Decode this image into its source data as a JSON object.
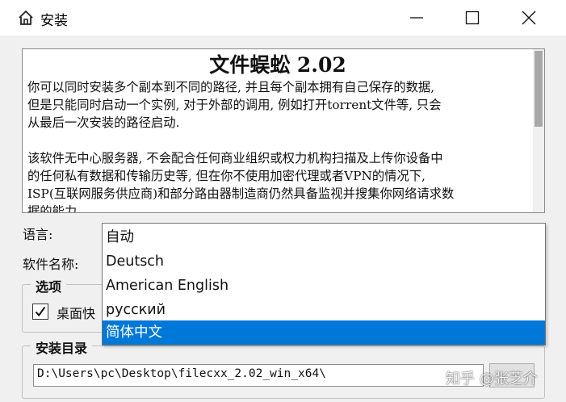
{
  "window": {
    "title": "安装",
    "icon": "home-icon",
    "controls": {
      "minimize": "minimize-icon",
      "maximize": "maximize-icon",
      "close": "close-icon"
    }
  },
  "description": {
    "heading": "文件蜈蚣 2.02",
    "paragraph1": [
      "你可以同时安装多个副本到不同的路径, 并且每个副本拥有自己保存的数据,",
      "但是只能同时启动一个实例, 对于外部的调用, 例如打开torrent文件等, 只会",
      "从最后一次安装的路径启动."
    ],
    "paragraph2": [
      "该软件无中心服务器, 不会配合任何商业组织或权力机构扫描及上传你设备中",
      "的任何私有数据和传输历史等, 但在你不使用加密代理或者VPN的情况下,",
      "ISP(互联网服务供应商)和部分路由器制造商仍然具备监视并搜集你网络请求数",
      "据的能力"
    ]
  },
  "form": {
    "language_label": "语言:",
    "software_name_label": "软件名称:"
  },
  "options": {
    "group_title": "选项",
    "desktop_shortcut_label": "桌面快",
    "desktop_shortcut_checked": true
  },
  "install_dir": {
    "group_title": "安装目录",
    "path_value": "D:\\Users\\pc\\Desktop\\filecxx_2.02_win_x64\\"
  },
  "language_dropdown": {
    "options": [
      "自动",
      "Deutsch",
      "American English",
      "русский",
      "简体中文"
    ],
    "selected": "简体中文"
  },
  "watermark": "知乎 @张芝介",
  "colors": {
    "selection": "#0078d7",
    "window_bg": "#f0f0f0",
    "titlebar_bg": "#ffffff"
  }
}
